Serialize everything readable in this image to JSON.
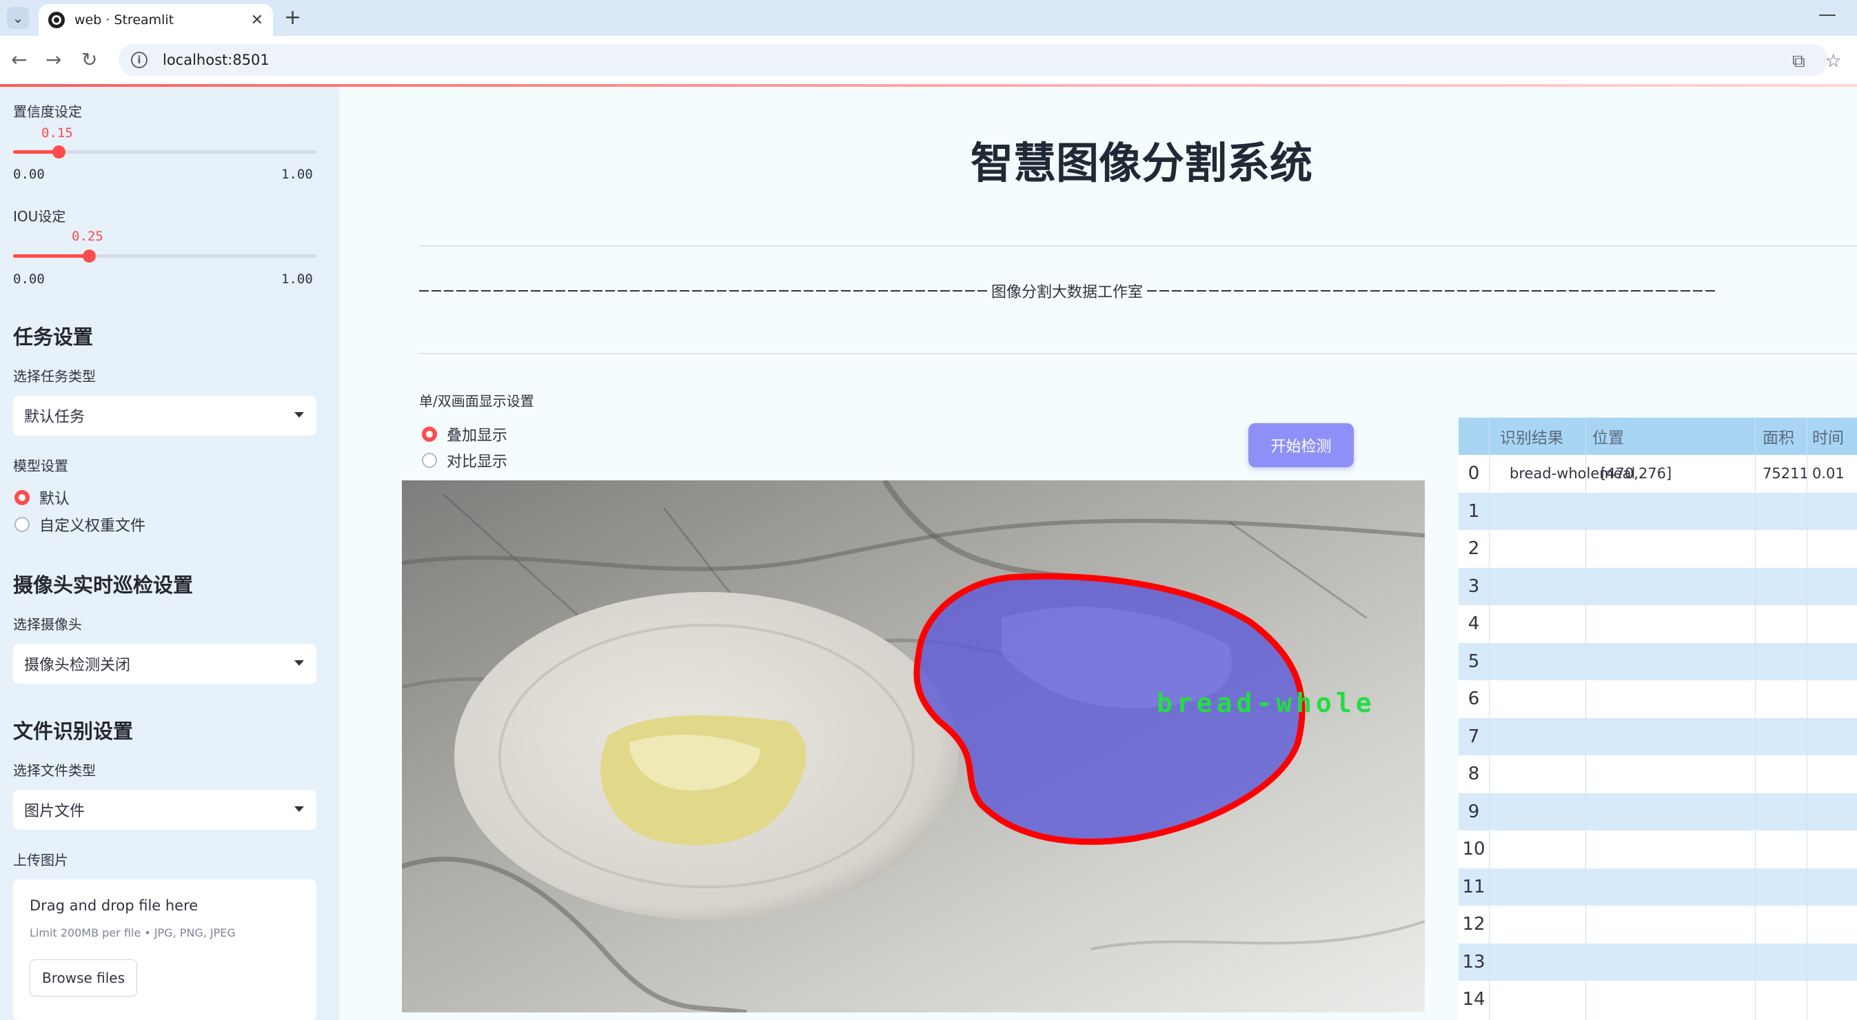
{
  "browser": {
    "tab_title": "web · Streamlit",
    "url": "localhost:8501"
  },
  "sidebar": {
    "confidence": {
      "label": "置信度设定",
      "value": "0.15",
      "min": "0.00",
      "max": "1.00",
      "fraction": 0.15
    },
    "iou": {
      "label": "IOU设定",
      "value": "0.25",
      "min": "0.00",
      "max": "1.00",
      "fraction": 0.25
    },
    "task_section": {
      "heading": "任务设置",
      "select_label": "选择任务类型",
      "select_value": "默认任务"
    },
    "model_section": {
      "label": "模型设置",
      "options": [
        "默认",
        "自定义权重文件"
      ],
      "selected": 0
    },
    "camera_section": {
      "heading": "摄像头实时巡检设置",
      "select_label": "选择摄像头",
      "select_value": "摄像头检测关闭"
    },
    "file_section": {
      "heading": "文件识别设置",
      "select_label": "选择文件类型",
      "select_value": "图片文件"
    },
    "upload": {
      "label": "上传图片",
      "title": "Drag and drop file here",
      "limit": "Limit 200MB per file • JPG, PNG, JPEG",
      "button": "Browse files"
    }
  },
  "main": {
    "title": "智慧图像分割系统",
    "subtitle": "图像分割大数据工作室",
    "display_label": "单/双画面显示设置",
    "display_options": [
      "叠加显示",
      "对比显示"
    ],
    "display_selected": 0,
    "start_button": "开始检测",
    "detection_overlay_label": "bread-whole"
  },
  "table": {
    "columns": [
      "识别结果",
      "位置",
      "面积",
      "时间"
    ],
    "rows": [
      {
        "index": "0",
        "result": "bread-wholemeal",
        "position": "[470,276]",
        "area": "75211",
        "time": "0.01"
      },
      {
        "index": "1"
      },
      {
        "index": "2"
      },
      {
        "index": "3"
      },
      {
        "index": "4"
      },
      {
        "index": "5"
      },
      {
        "index": "6"
      },
      {
        "index": "7"
      },
      {
        "index": "8"
      },
      {
        "index": "9"
      },
      {
        "index": "10"
      },
      {
        "index": "11"
      },
      {
        "index": "12"
      },
      {
        "index": "13"
      },
      {
        "index": "14"
      }
    ]
  },
  "colors": {
    "accent": "#ff4b4b",
    "button": "#8f90f7",
    "table_header": "#a9d5f5",
    "mask_outline": "#ff0000",
    "label_text": "#22dd44"
  }
}
